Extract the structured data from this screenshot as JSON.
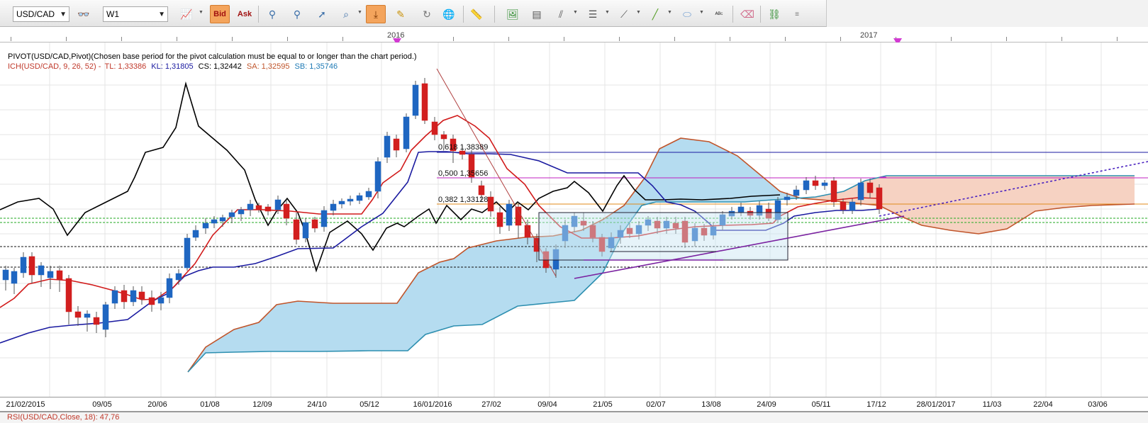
{
  "toolbar": {
    "symbol": "USD/CAD",
    "timeframe": "W1",
    "bid_label": "Bid",
    "ask_label": "Ask"
  },
  "timebar": {
    "year_2016": "2016",
    "year_2017": "2017"
  },
  "legend": {
    "pivot_text": "PIVOT(USD/CAD,Pivot)(Chosen base period for the pivot calculation must be equal to or longer than the chart period.)",
    "ichimoku": {
      "name": "ICH(USD/CAD, 9, 26, 52) -",
      "tl": "TL: 1,33386",
      "kl": "KL: 1,31805",
      "cs": "CS: 1,32442",
      "sa": "SA: 1,32595",
      "sb": "SB: 1,35746",
      "colors": {
        "name": "#c0392b",
        "tl": "#c0392b",
        "kl": "#1a1aa0",
        "cs": "#000000",
        "sa": "#c0552b",
        "sb": "#1f7bb6"
      }
    }
  },
  "fibonacci": [
    {
      "label": "0,618 1,38389",
      "price": 1.38389
    },
    {
      "label": "0,500 1,35656",
      "price": 1.35656
    },
    {
      "label": "0,382 1,33128",
      "price": 1.33128
    }
  ],
  "date_axis": [
    "21/02/2015",
    "09/05",
    "20/06",
    "01/08",
    "12/09",
    "24/10",
    "05/12",
    "16/01/2016",
    "27/02",
    "09/04",
    "21/05",
    "02/07",
    "13/08",
    "24/09",
    "05/11",
    "17/12",
    "28/01/2017",
    "11/03",
    "22/04",
    "03/06"
  ],
  "bottom_indicator": "RSI(USD/CAD,Close, 18): 47,76",
  "chart_data": {
    "type": "candlestick",
    "symbol": "USD/CAD",
    "timeframe": "W1",
    "indicators": [
      "Ichimoku Kinko Hyo (9, 26, 52)",
      "Pivot",
      "Fibonacci retracement"
    ],
    "ichimoku_values": {
      "TL": 1.33386,
      "KL": 1.31805,
      "CS": 1.32442,
      "SA": 1.32595,
      "SB": 1.35746
    },
    "fibonacci_levels": [
      {
        "ratio": 0.618,
        "price": 1.38389
      },
      {
        "ratio": 0.5,
        "price": 1.35656
      },
      {
        "ratio": 0.382,
        "price": 1.33128
      }
    ],
    "x_tick_labels": [
      "21/02/2015",
      "09/05",
      "20/06",
      "01/08",
      "12/09",
      "24/10",
      "05/12",
      "16/01/2016",
      "27/02",
      "09/04",
      "21/05",
      "02/07",
      "13/08",
      "24/09",
      "05/11",
      "17/12",
      "28/01/2017",
      "11/03",
      "22/04",
      "03/06"
    ],
    "colors": {
      "bull": "#1f66c1",
      "bear": "#d21f1f",
      "cloud_bull": "#b5dcf0",
      "cloud_bear": "#f6d2c2"
    }
  }
}
